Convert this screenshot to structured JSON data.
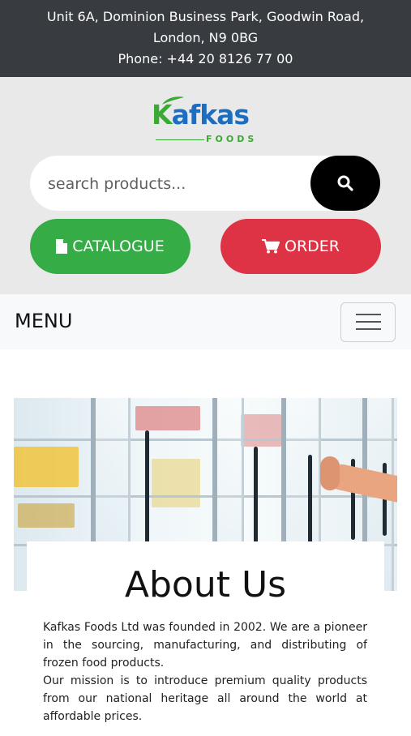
{
  "topbar": {
    "address_line1": "Unit 6A, Dominion Business Park, Goodwin Road,",
    "address_line2": "London, N9 0BG",
    "phone": "Phone: +44 20 8126 77 00"
  },
  "logo": {
    "name_first": "K",
    "name_rest": "afkas",
    "sub": "FOODS"
  },
  "search": {
    "placeholder": "search products...",
    "icon": "search-icon"
  },
  "buttons": {
    "catalogue": "CATALOGUE",
    "catalogue_icon": "file-icon",
    "order": "ORDER",
    "order_icon": "cart-icon"
  },
  "nav": {
    "menu_label": "MENU",
    "toggler_icon": "hamburger-icon"
  },
  "about": {
    "title": "About Us",
    "paragraph1": "Kafkas Foods Ltd was founded in 2002. We are a pioneer in the sourcing, manufacturing, and distributing of frozen food products.",
    "paragraph2": "Our mission is to introduce premium quality products from our national heritage all around the world at affordable prices."
  },
  "colors": {
    "topbar": "#383c40",
    "catalogue": "#35ac46",
    "order": "#dd3345",
    "search_button": "#000000"
  }
}
